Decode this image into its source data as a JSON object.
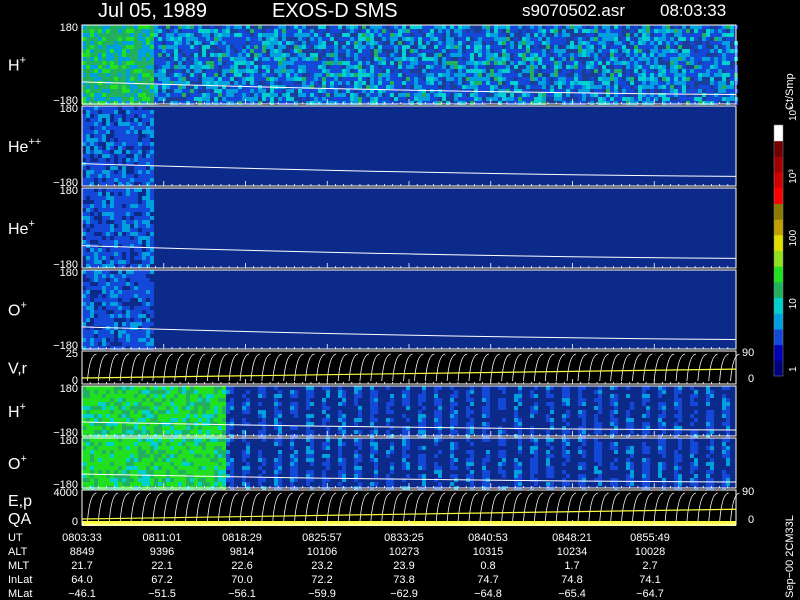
{
  "header": {
    "date": "Jul 05, 1989",
    "instrument": "EXOS-D SMS",
    "file": "s9070502.asr",
    "time": "08:03:33"
  },
  "colorbar": {
    "unit": "Ct/Smp",
    "tick_labels": [
      "1",
      "10",
      "100",
      "10³",
      "10⁴"
    ],
    "colors": [
      "#00007a",
      "#0000b4",
      "#1448d8",
      "#00a0e0",
      "#00d0d0",
      "#20b060",
      "#20e020",
      "#90e020",
      "#e0e000",
      "#c0a000",
      "#8a7a00",
      "#ff0000",
      "#d00000",
      "#a00000",
      "#700000",
      "#ffffff"
    ]
  },
  "panels": [
    {
      "id": "h1",
      "label": "H",
      "sup": "+",
      "ymax": "180",
      "ymin": "−180",
      "activity_end": 0.11,
      "bg": "#1a3f9a",
      "noise": "dense"
    },
    {
      "id": "he2",
      "label": "He",
      "sup": "++",
      "ymax": "180",
      "ymin": "−180",
      "activity_end": 0.11,
      "bg": "#0c2a8a",
      "noise": "sparse"
    },
    {
      "id": "he1",
      "label": "He",
      "sup": "+",
      "ymax": "180",
      "ymin": "−180",
      "activity_end": 0.11,
      "bg": "#0c2a8a",
      "noise": "sparse"
    },
    {
      "id": "o1",
      "label": "O",
      "sup": "+",
      "ymax": "180",
      "ymin": "−180",
      "activity_end": 0.11,
      "bg": "#0c2a8a",
      "noise": "sparse"
    },
    {
      "id": "vr",
      "label": "V,r",
      "sup": "",
      "ymax": "25",
      "ymin": "0",
      "right_top": "90",
      "right_bottom": "0"
    },
    {
      "id": "h2",
      "label": "H",
      "sup": "+",
      "ymax": "180",
      "ymin": "−180",
      "bg": "#0c2a8a",
      "noise": "stripes"
    },
    {
      "id": "o2",
      "label": "O",
      "sup": "+",
      "ymax": "180",
      "ymin": "−180",
      "bg": "#0c2a8a",
      "noise": "stripes"
    },
    {
      "id": "ep",
      "label": "E,p",
      "label2": "QA",
      "sup": "",
      "ymax": "4000",
      "ymin": "0",
      "right_top": "90",
      "right_bottom": "0"
    }
  ],
  "ephemeris": {
    "row_labels": [
      "UT",
      "ALT",
      "MLT",
      "InLat",
      "MLat"
    ],
    "columns": [
      {
        "UT": "0803:33",
        "ALT": "8849",
        "MLT": "21.7",
        "InLat": "64.0",
        "MLat": "−46.1"
      },
      {
        "UT": "0811:01",
        "ALT": "9396",
        "MLT": "22.1",
        "InLat": "67.2",
        "MLat": "−51.5"
      },
      {
        "UT": "0818:29",
        "ALT": "9814",
        "MLT": "22.6",
        "InLat": "70.0",
        "MLat": "−56.1"
      },
      {
        "UT": "0825:57",
        "ALT": "10106",
        "MLT": "23.2",
        "InLat": "72.2",
        "MLat": "−59.9"
      },
      {
        "UT": "0833:25",
        "ALT": "10273",
        "MLT": "23.9",
        "InLat": "73.8",
        "MLat": "−62.9"
      },
      {
        "UT": "0840:53",
        "ALT": "10315",
        "MLT": "0.8",
        "InLat": "74.7",
        "MLat": "−64.8"
      },
      {
        "UT": "0848:21",
        "ALT": "10234",
        "MLT": "1.7",
        "InLat": "74.8",
        "MLat": "−65.4"
      },
      {
        "UT": "0855:49",
        "ALT": "10028",
        "MLT": "2.7",
        "InLat": "74.1",
        "MLat": "−64.7"
      }
    ]
  },
  "footer_stamp": "Sep−00 2CM33L",
  "chart_data": {
    "type": "heatmap",
    "title": "Jul 05, 1989   EXOS-D SMS",
    "subtitle": "s9070502.asr  08:03:33",
    "x": [
      "0803:33",
      "0811:01",
      "0818:29",
      "0825:57",
      "0833:25",
      "0840:53",
      "0848:21",
      "0855:49"
    ],
    "xlabel": "UT",
    "colorbar_label": "Ct/Smp",
    "colorbar_scale": "log",
    "colorbar_range": [
      1,
      10000
    ],
    "series": [
      {
        "name": "H+",
        "ylim": [
          -180,
          180
        ]
      },
      {
        "name": "He++",
        "ylim": [
          -180,
          180
        ]
      },
      {
        "name": "He+",
        "ylim": [
          -180,
          180
        ]
      },
      {
        "name": "O+",
        "ylim": [
          -180,
          180
        ]
      },
      {
        "name": "V,r",
        "ylim": [
          0,
          25
        ],
        "right_ylim": [
          0,
          90
        ]
      },
      {
        "name": "H+",
        "ylim": [
          -180,
          180
        ]
      },
      {
        "name": "O+",
        "ylim": [
          -180,
          180
        ]
      },
      {
        "name": "E,p",
        "ylim": [
          0,
          4000
        ],
        "right_ylim": [
          0,
          90
        ]
      }
    ],
    "ephemeris": {
      "ALT": [
        8849,
        9396,
        9814,
        10106,
        10273,
        10315,
        10234,
        10028
      ],
      "MLT": [
        21.7,
        22.1,
        22.6,
        23.2,
        23.9,
        0.8,
        1.7,
        2.7
      ],
      "InLat": [
        64.0,
        67.2,
        70.0,
        72.2,
        73.8,
        74.7,
        74.8,
        74.1
      ],
      "MLat": [
        -46.1,
        -51.5,
        -56.1,
        -59.9,
        -62.9,
        -64.8,
        -65.4,
        -64.7
      ]
    }
  }
}
